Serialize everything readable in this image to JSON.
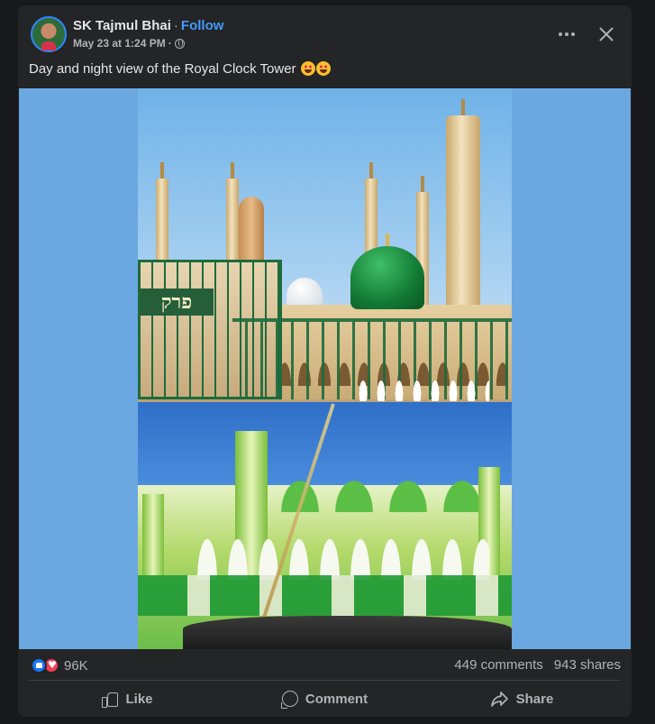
{
  "post": {
    "author": "SK Tajmul Bhai",
    "separator": "·",
    "follow_label": "Follow",
    "timestamp": "May 23 at 1:24 PM",
    "meta_separator": "·",
    "privacy_icon": "globe-icon",
    "caption": "Day and night view of the Royal Clock Tower",
    "caption_emojis": [
      "star-struck-emoji",
      "star-struck-emoji"
    ]
  },
  "header_actions": {
    "more_icon": "more-horizontal-icon",
    "close_icon": "close-icon"
  },
  "media": {
    "photo_sign_text": "פרק"
  },
  "stats": {
    "reactions": [
      "like",
      "love"
    ],
    "reaction_count": "96K",
    "comments": "449 comments",
    "shares": "943 shares"
  },
  "actions": {
    "like_label": "Like",
    "comment_label": "Comment",
    "share_label": "Share"
  },
  "colors": {
    "background": "#18191a",
    "card": "#242526",
    "text_primary": "#e4e6eb",
    "text_secondary": "#b0b3b8",
    "accent": "#4599ff",
    "like_blue": "#1877f2",
    "love_red": "#f33e58",
    "media_bg": "#6ba7e0"
  }
}
